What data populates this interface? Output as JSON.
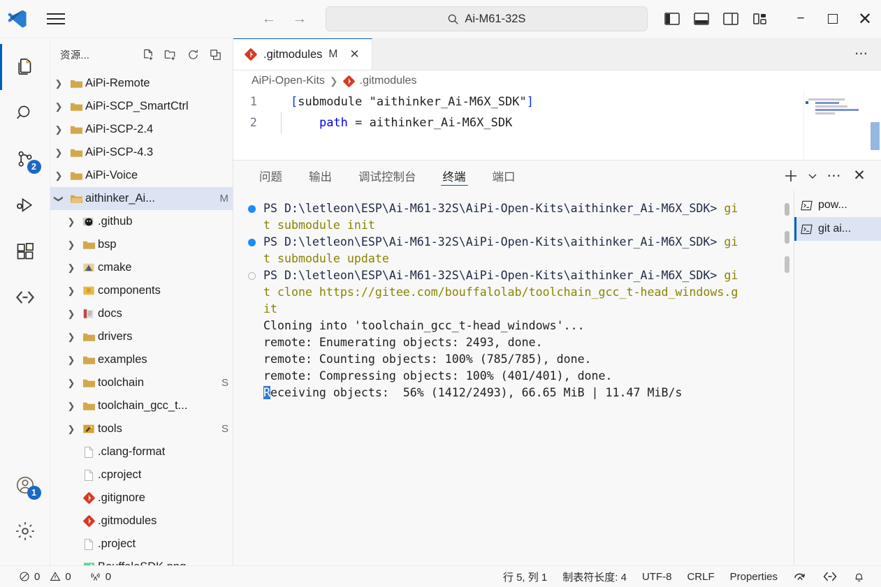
{
  "titlebar": {
    "logo_icon": "vscode-logo-icon",
    "menu_icon": "hamburger-menu-icon",
    "back_icon": "arrow-left-icon",
    "forward_icon": "arrow-right-icon",
    "search": {
      "icon": "search-icon",
      "value": "Ai-M61-32S",
      "placeholder": "Search"
    },
    "layout_buttons": [
      {
        "name": "toggle-primary-sidebar-icon",
        "label": "Toggle Primary Side Bar"
      },
      {
        "name": "toggle-panel-icon",
        "label": "Toggle Panel"
      },
      {
        "name": "toggle-secondary-sidebar-icon",
        "label": "Toggle Secondary Side Bar"
      },
      {
        "name": "customize-layout-icon",
        "label": "Customize Layout"
      }
    ],
    "window_controls": {
      "minimize": "−",
      "maximize": "□",
      "close": "✕"
    }
  },
  "activitybar": {
    "items": [
      {
        "name": "explorer",
        "icon": "files-icon",
        "active": true,
        "badge": ""
      },
      {
        "name": "search",
        "icon": "search-icon",
        "active": false,
        "badge": ""
      },
      {
        "name": "source-control",
        "icon": "source-control-icon",
        "active": false,
        "badge": "2"
      },
      {
        "name": "run-and-debug",
        "icon": "run-debug-icon",
        "active": false,
        "badge": ""
      },
      {
        "name": "extensions",
        "icon": "extensions-icon",
        "active": false,
        "badge": ""
      },
      {
        "name": "remote-explorer",
        "icon": "remote-icon",
        "active": false,
        "badge": ""
      }
    ],
    "bottom": [
      {
        "name": "accounts",
        "icon": "account-icon",
        "badge": "1"
      },
      {
        "name": "manage",
        "icon": "gear-icon",
        "badge": ""
      }
    ]
  },
  "sidebar": {
    "title": "资源...",
    "actions": [
      {
        "name": "new-file-icon",
        "label": "New File"
      },
      {
        "name": "new-folder-icon",
        "label": "New Folder"
      },
      {
        "name": "refresh-icon",
        "label": "Refresh Explorer"
      },
      {
        "name": "collapse-all-icon",
        "label": "Collapse Folders in Explorer"
      }
    ],
    "tree": [
      {
        "label": "AiPi-Remote",
        "type": "folder",
        "icon": "folder-icon",
        "expanded": false,
        "indent": 0,
        "badge": "",
        "selected": false
      },
      {
        "label": "AiPi-SCP_SmartCtrl",
        "type": "folder",
        "icon": "folder-icon",
        "expanded": false,
        "indent": 0,
        "badge": "",
        "selected": false
      },
      {
        "label": "AiPi-SCP-2.4",
        "type": "folder",
        "icon": "folder-icon",
        "expanded": false,
        "indent": 0,
        "badge": "",
        "selected": false
      },
      {
        "label": "AiPi-SCP-4.3",
        "type": "folder",
        "icon": "folder-icon",
        "expanded": false,
        "indent": 0,
        "badge": "",
        "selected": false
      },
      {
        "label": "AiPi-Voice",
        "type": "folder",
        "icon": "folder-icon",
        "expanded": false,
        "indent": 0,
        "badge": "",
        "selected": false
      },
      {
        "label": "aithinker_Ai...",
        "type": "folder",
        "icon": "folder-open-icon",
        "expanded": true,
        "indent": 0,
        "badge": "M",
        "selected": true
      },
      {
        "label": ".github",
        "type": "folder",
        "icon": "github-icon",
        "expanded": false,
        "indent": 1,
        "badge": "",
        "selected": false
      },
      {
        "label": "bsp",
        "type": "folder",
        "icon": "folder-icon",
        "expanded": false,
        "indent": 1,
        "badge": "",
        "selected": false
      },
      {
        "label": "cmake",
        "type": "folder",
        "icon": "cmake-icon",
        "expanded": false,
        "indent": 1,
        "badge": "",
        "selected": false
      },
      {
        "label": "components",
        "type": "folder",
        "icon": "components-icon",
        "expanded": false,
        "indent": 1,
        "badge": "",
        "selected": false
      },
      {
        "label": "docs",
        "type": "folder",
        "icon": "docs-icon",
        "expanded": false,
        "indent": 1,
        "badge": "",
        "selected": false
      },
      {
        "label": "drivers",
        "type": "folder",
        "icon": "folder-icon",
        "expanded": false,
        "indent": 1,
        "badge": "",
        "selected": false
      },
      {
        "label": "examples",
        "type": "folder",
        "icon": "folder-icon",
        "expanded": false,
        "indent": 1,
        "badge": "",
        "selected": false
      },
      {
        "label": "toolchain",
        "type": "folder",
        "icon": "folder-icon",
        "expanded": false,
        "indent": 1,
        "badge": "S",
        "selected": false
      },
      {
        "label": "toolchain_gcc_t...",
        "type": "folder",
        "icon": "folder-icon",
        "expanded": false,
        "indent": 1,
        "badge": "",
        "selected": false
      },
      {
        "label": "tools",
        "type": "folder",
        "icon": "tools-icon",
        "expanded": false,
        "indent": 1,
        "badge": "S",
        "selected": false
      },
      {
        "label": ".clang-format",
        "type": "file",
        "icon": "file-icon",
        "expanded": false,
        "indent": 1,
        "badge": "",
        "selected": false
      },
      {
        "label": ".cproject",
        "type": "file",
        "icon": "file-icon",
        "expanded": false,
        "indent": 1,
        "badge": "",
        "selected": false
      },
      {
        "label": ".gitignore",
        "type": "file",
        "icon": "git-icon",
        "expanded": false,
        "indent": 1,
        "badge": "",
        "selected": false
      },
      {
        "label": ".gitmodules",
        "type": "file",
        "icon": "git-icon",
        "expanded": false,
        "indent": 1,
        "badge": "",
        "selected": false
      },
      {
        "label": ".project",
        "type": "file",
        "icon": "file-icon",
        "expanded": false,
        "indent": 1,
        "badge": "",
        "selected": false
      },
      {
        "label": "BouffaloSDK.png",
        "type": "file",
        "icon": "image-icon",
        "expanded": false,
        "indent": 1,
        "badge": "",
        "selected": false
      }
    ]
  },
  "editor": {
    "tab": {
      "icon": "git-icon",
      "label": ".gitmodules",
      "modified_badge": "M",
      "close_icon": "close-icon"
    },
    "more_actions": "⋯",
    "breadcrumb": [
      {
        "label": "AiPi-Open-Kits",
        "icon": ""
      },
      {
        "label": ".gitmodules",
        "icon": "git-icon"
      }
    ],
    "lines": [
      {
        "num": "1",
        "parts": [
          {
            "t": "[",
            "c": "br"
          },
          {
            "t": "submodule \"aithinker_Ai-M6X_SDK\"",
            "c": "txt"
          },
          {
            "t": "]",
            "c": "br"
          }
        ]
      },
      {
        "num": "2",
        "indent": true,
        "parts": [
          {
            "t": "    ",
            "c": "txt"
          },
          {
            "t": "path",
            "c": "key"
          },
          {
            "t": " = aithinker_Ai-M6X_SDK",
            "c": "txt"
          }
        ]
      }
    ]
  },
  "panel": {
    "tabs": [
      {
        "label": "问题",
        "active": false
      },
      {
        "label": "输出",
        "active": false
      },
      {
        "label": "调试控制台",
        "active": false
      },
      {
        "label": "终端",
        "active": true
      },
      {
        "label": "端口",
        "active": false
      }
    ],
    "actions": [
      {
        "name": "new-terminal-icon",
        "label": "+"
      },
      {
        "name": "split-dropdown-icon",
        "label": "⌄"
      },
      {
        "name": "panel-more-icon",
        "label": "⋯"
      },
      {
        "name": "close-panel-icon",
        "label": "✕"
      }
    ],
    "terminal_lines": [
      {
        "marker": "filled",
        "segments": [
          {
            "t": "PS D:\\letleon\\ESP\\Ai-M61-32S\\AiPi-Open-Kits\\aithinker_Ai-M6X_SDK> ",
            "c": "prompt"
          },
          {
            "t": "gi",
            "c": "cmd"
          }
        ]
      },
      {
        "marker": "",
        "segments": [
          {
            "t": "t submodule init",
            "c": "cmd"
          }
        ]
      },
      {
        "marker": "filled",
        "segments": [
          {
            "t": "PS D:\\letleon\\ESP\\Ai-M61-32S\\AiPi-Open-Kits\\aithinker_Ai-M6X_SDK> ",
            "c": "prompt"
          },
          {
            "t": "gi",
            "c": "cmd"
          }
        ]
      },
      {
        "marker": "",
        "segments": [
          {
            "t": "t submodule update",
            "c": "cmd"
          }
        ]
      },
      {
        "marker": "hollow",
        "segments": [
          {
            "t": "PS D:\\letleon\\ESP\\Ai-M61-32S\\AiPi-Open-Kits\\aithinker_Ai-M6X_SDK> ",
            "c": "prompt"
          },
          {
            "t": "gi",
            "c": "cmd"
          }
        ]
      },
      {
        "marker": "",
        "segments": [
          {
            "t": "t clone https://gitee.com/bouffalolab/toolchain_gcc_t-head_windows.g",
            "c": "cmd"
          }
        ]
      },
      {
        "marker": "",
        "segments": [
          {
            "t": "it",
            "c": "cmd"
          }
        ]
      },
      {
        "marker": "",
        "segments": [
          {
            "t": "Cloning into 'toolchain_gcc_t-head_windows'...",
            "c": "out"
          }
        ]
      },
      {
        "marker": "",
        "segments": [
          {
            "t": "remote: Enumerating objects: 2493, done.",
            "c": "out"
          }
        ]
      },
      {
        "marker": "",
        "segments": [
          {
            "t": "remote: Counting objects: 100% (785/785), done.",
            "c": "out"
          }
        ]
      },
      {
        "marker": "",
        "segments": [
          {
            "t": "remote: Compressing objects: 100% (401/401), done.",
            "c": "out"
          }
        ]
      },
      {
        "marker": "",
        "segments": [
          {
            "t": "R",
            "c": "cursor"
          },
          {
            "t": "eceiving objects:  56% (1412/2493), 66.65 MiB | 11.47 MiB/s",
            "c": "out"
          }
        ]
      }
    ],
    "terminal_list": [
      {
        "icon": "terminal-icon",
        "label": "pow...",
        "selected": false
      },
      {
        "icon": "terminal-icon",
        "label": "git  ai...",
        "selected": true
      }
    ]
  },
  "statusbar": {
    "left": [
      {
        "name": "errors",
        "icon": "error-icon",
        "value": "0"
      },
      {
        "name": "warnings",
        "icon": "warning-icon",
        "value": "0"
      },
      {
        "name": "ports",
        "icon": "ports-icon",
        "value": "0"
      }
    ],
    "right": [
      {
        "name": "cursor-position",
        "icon": "",
        "value": "行 5, 列 1"
      },
      {
        "name": "indentation",
        "icon": "",
        "value": "制表符长度: 4"
      },
      {
        "name": "encoding",
        "icon": "",
        "value": "UTF-8"
      },
      {
        "name": "eol",
        "icon": "",
        "value": "CRLF"
      },
      {
        "name": "language-mode",
        "icon": "",
        "value": "Properties"
      },
      {
        "name": "tortoise-git",
        "icon": "tortoise-icon",
        "value": ""
      },
      {
        "name": "remote-host",
        "icon": "remote-icon",
        "value": ""
      },
      {
        "name": "notifications",
        "icon": "bell-icon",
        "value": ""
      }
    ]
  },
  "colors": {
    "accent": "#005fb8",
    "badge": "#1a69c7",
    "selection": "#dce4f4",
    "git_red": "#d73a22",
    "folder": "#d3a84c",
    "terminal_cmd": "#8a8400",
    "cursor": "#2f7bd8"
  }
}
